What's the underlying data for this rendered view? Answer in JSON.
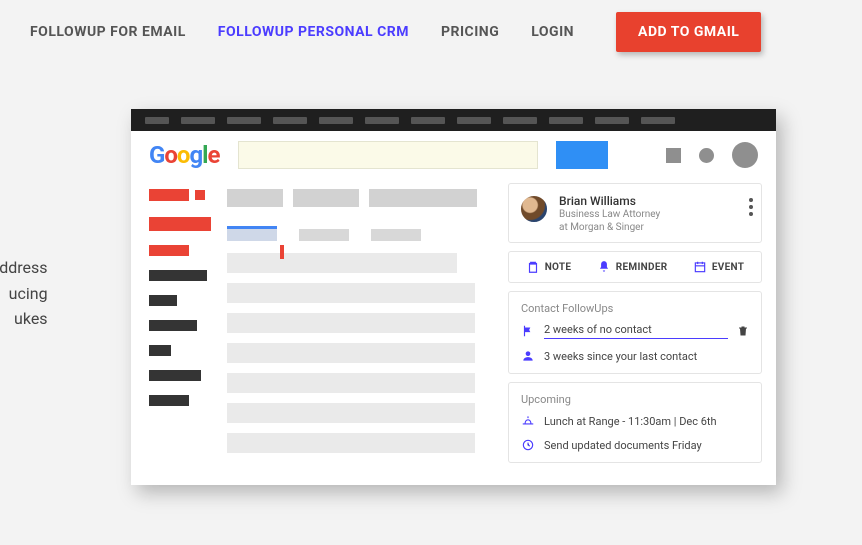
{
  "nav": {
    "email": "FOLLOWUP FOR EMAIL",
    "crm": "FOLLOWUP PERSONAL CRM",
    "pricing": "PRICING",
    "login": "LOGIN",
    "cta": "ADD TO GMAIL"
  },
  "sidetext": {
    "l1": "and address",
    "l2": "ucing",
    "l3": "ukes"
  },
  "crm": {
    "contact": {
      "name": "Brian Williams",
      "sub1": "Business Law Attorney",
      "sub2": "at Morgan & Singer"
    },
    "actions": {
      "note": "NOTE",
      "reminder": "REMINDER",
      "event": "EVENT"
    },
    "followups": {
      "title": "Contact FollowUps",
      "rule": "2 weeks of no contact",
      "since": "3 weeks since your last contact"
    },
    "upcoming": {
      "title": "Upcoming",
      "event1": "Lunch at Range - 11:30am | Dec 6th",
      "event2": "Send updated documents Friday"
    }
  },
  "colors": {
    "accent": "#4b3cff",
    "brandRed": "#e8412e"
  }
}
